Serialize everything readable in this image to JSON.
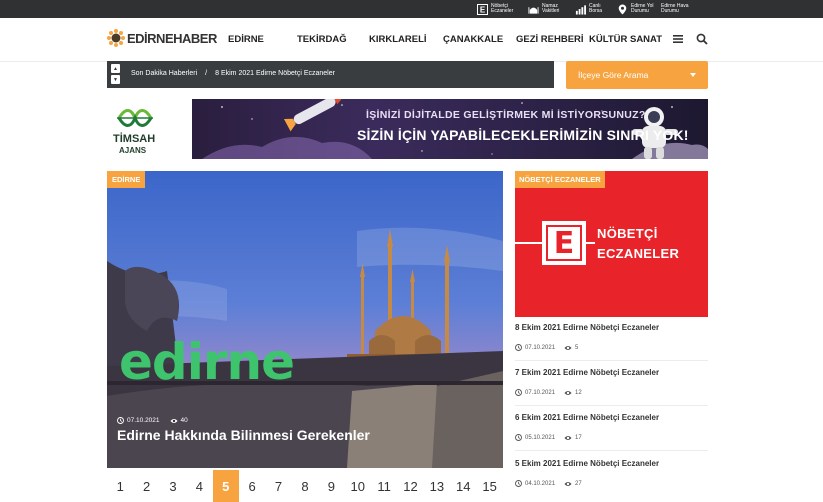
{
  "topbar": {
    "items": [
      {
        "label": "Nöbetçi Eczaneler",
        "icon": "pharmacy-e-icon"
      },
      {
        "label": "Namaz Vakitleri",
        "icon": "mosque-icon"
      },
      {
        "label": "Canlı Borsa",
        "icon": "chart-bars-icon"
      },
      {
        "label": "Edirne Yol Durumu",
        "icon": "location-pin-icon"
      },
      {
        "label": "Edirne Hava Durumu",
        "icon": "weather-icon"
      }
    ]
  },
  "header": {
    "logo": "EDİRNEHABER",
    "nav": [
      "EDİRNE",
      "TEKİRDAĞ",
      "KIRKLARELİ",
      "ÇANAKKALE",
      "GEZİ REHBERİ",
      "KÜLTÜR SANAT"
    ],
    "menu_icon": "hamburger-menu-icon",
    "search_icon": "search-icon"
  },
  "ticker": {
    "label": "Son Dakika Haberleri",
    "separator": "/",
    "headline": "8 Ekim 2021 Edirne Nöbetçi Eczaneler"
  },
  "district_select": {
    "label": "İlçeye Göre Arama"
  },
  "banner": {
    "brand_name": "TİMSAH",
    "brand_sub": "AJANS",
    "line1": "İŞİNİZİ DİJİTALDE GELİŞTİRMEK Mİ İSTİYORSUNUZ?",
    "line2": "SİZİN İÇİN YAPABİLECEKLERİMİZİN SINIRI YOK!"
  },
  "hero": {
    "category": "EDİRNE",
    "sign_text": "edirne",
    "date": "07.10.2021",
    "views": "40",
    "title": "Edirne Hakkında Bilinmesi Gerekenler"
  },
  "pagination": {
    "pages": [
      "1",
      "2",
      "3",
      "4",
      "5",
      "6",
      "7",
      "8",
      "9",
      "10",
      "11",
      "12",
      "13",
      "14",
      "15"
    ],
    "active": 5
  },
  "sidebar": {
    "category": "NÖBETÇİ ECZANELER",
    "image_mark": "E",
    "image_line1": "NÖBETÇİ",
    "image_line2": "ECZANELER",
    "items": [
      {
        "title": "8 Ekim 2021 Edirne Nöbetçi Eczaneler",
        "date": "07.10.2021",
        "views": "5"
      },
      {
        "title": "7 Ekim 2021 Edirne Nöbetçi Eczaneler",
        "date": "07.10.2021",
        "views": "12"
      },
      {
        "title": "6 Ekim 2021 Edirne Nöbetçi Eczaneler",
        "date": "05.10.2021",
        "views": "17"
      },
      {
        "title": "5 Ekim 2021 Edirne Nöbetçi Eczaneler",
        "date": "04.10.2021",
        "views": "27"
      }
    ]
  },
  "colors": {
    "accent": "#f7a440",
    "topbar": "#2f3133",
    "ticker": "#3a3d40",
    "pharmacy_red": "#e8242a"
  }
}
